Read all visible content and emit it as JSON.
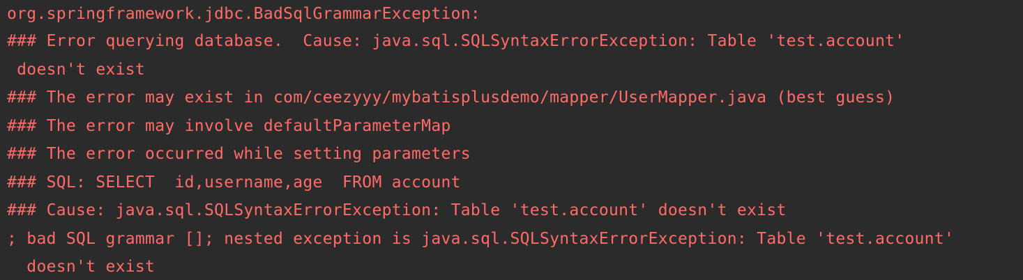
{
  "console": {
    "text_color": "#ff6b68",
    "background": "#2b2b2b",
    "lines": [
      "org.springframework.jdbc.BadSqlGrammarException:",
      "### Error querying database.  Cause: java.sql.SQLSyntaxErrorException: Table 'test.account'",
      " doesn't exist",
      "### The error may exist in com/ceezyyy/mybatisplusdemo/mapper/UserMapper.java (best guess)",
      "### The error may involve defaultParameterMap",
      "### The error occurred while setting parameters",
      "### SQL: SELECT  id,username,age  FROM account",
      "### Cause: java.sql.SQLSyntaxErrorException: Table 'test.account' doesn't exist",
      "; bad SQL grammar []; nested exception is java.sql.SQLSyntaxErrorException: Table 'test.account'",
      "  doesn't exist"
    ]
  }
}
